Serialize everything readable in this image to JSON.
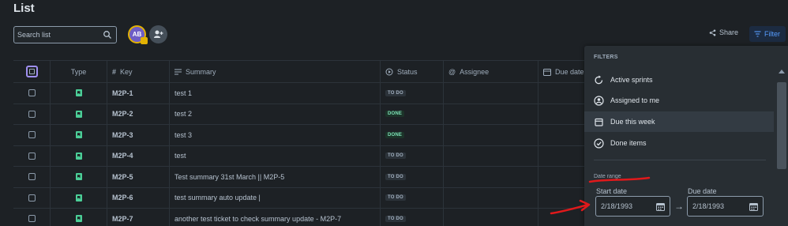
{
  "page": {
    "title": "List"
  },
  "toolbar": {
    "search_placeholder": "Search list",
    "avatar_initials": "AB",
    "share_label": "Share",
    "filter_label": "Filter"
  },
  "table": {
    "headers": {
      "type": "Type",
      "key": "Key",
      "summary": "Summary",
      "status": "Status",
      "assignee": "Assignee",
      "due": "Due date"
    },
    "rows": [
      {
        "key": "M2P-1",
        "summary": "test 1",
        "status": "TO DO",
        "status_kind": "todo"
      },
      {
        "key": "M2P-2",
        "summary": "test 2",
        "status": "DONE",
        "status_kind": "done"
      },
      {
        "key": "M2P-3",
        "summary": "test 3",
        "status": "DONE",
        "status_kind": "done"
      },
      {
        "key": "M2P-4",
        "summary": "test",
        "status": "TO DO",
        "status_kind": "todo"
      },
      {
        "key": "M2P-5",
        "summary": "Test summary 31st March || M2P-5",
        "status": "TO DO",
        "status_kind": "todo"
      },
      {
        "key": "M2P-6",
        "summary": "test summary auto update |",
        "status": "TO DO",
        "status_kind": "todo"
      },
      {
        "key": "M2P-7",
        "summary": "another test ticket to check summary update - M2P-7",
        "status": "TO DO",
        "status_kind": "todo"
      }
    ]
  },
  "filters": {
    "heading": "FILTERS",
    "items": [
      {
        "label": "Active sprints",
        "icon": "sprint-icon"
      },
      {
        "label": "Assigned to me",
        "icon": "person-icon"
      },
      {
        "label": "Due this week",
        "icon": "calendar-icon"
      },
      {
        "label": "Done items",
        "icon": "check-circle-icon"
      }
    ],
    "date_range_label": "Date range",
    "start_label": "Start date",
    "start_value": "2/18/1993",
    "due_label": "Due date",
    "due_value": "2/18/1993"
  },
  "colors": {
    "background": "#1d2125",
    "panel": "#282e33",
    "accent": "#579dff",
    "annotation": "#e0191b"
  }
}
